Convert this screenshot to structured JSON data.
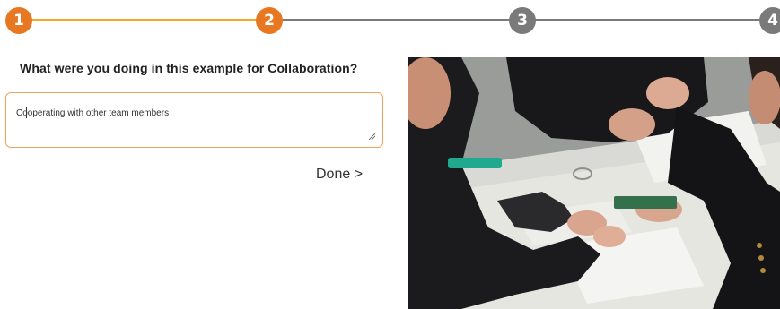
{
  "stepper": {
    "steps": [
      {
        "label": "1",
        "state": "completed"
      },
      {
        "label": "2",
        "state": "active"
      },
      {
        "label": "3",
        "state": "pending"
      },
      {
        "label": "4",
        "state": "pending"
      }
    ],
    "colors": {
      "active": "#e87722",
      "pending": "#7a7a7a"
    }
  },
  "question": {
    "text": "What were you doing in this example for Collaboration?"
  },
  "answer": {
    "value": "Cooperating with other team members"
  },
  "actions": {
    "done_label": "Done >"
  },
  "photo": {
    "description_icon": "team-collaboration-photo"
  }
}
